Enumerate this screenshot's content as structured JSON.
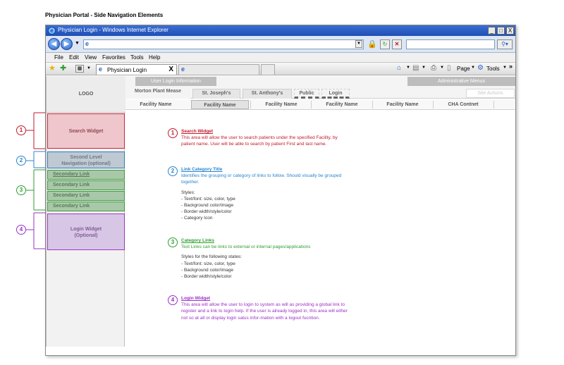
{
  "heading": "Physician Portal - Side Navigation Elements",
  "browser": {
    "title": "Physician Login - Windows Internet Explorer",
    "window_buttons": [
      "_",
      "□",
      "X"
    ],
    "menu": [
      "File",
      "Edit",
      "View",
      "Favorites",
      "Tools",
      "Help"
    ],
    "active_tab": "Physician Login",
    "tab_close": "X",
    "commands": [
      "Page",
      "Tools"
    ],
    "chevron": "»"
  },
  "portal": {
    "logo": "LOGO",
    "user_login_info": "User Login Information",
    "admin_menus": "Administrative Menus",
    "tabs": [
      "Morton Plant Mease",
      "St. Joseph's",
      "St. Anthony's",
      "Public",
      "Login"
    ],
    "site_actions": "Site Actions",
    "facilities": [
      "Facility Name",
      "Facility Name",
      "Facility Name",
      "Facility Name",
      "Facility Name",
      "CHA Contnet"
    ],
    "search_widget": "Search Widget",
    "second_level_nav": [
      "Second Level",
      "Navigation (optional)"
    ],
    "secondary_links": [
      "Secondary Link",
      "Secondary Link",
      "Secondary Link",
      "Secondary Link"
    ],
    "login_widget": [
      "Login Widget",
      "(Optional)"
    ]
  },
  "callouts": [
    "1",
    "2",
    "3",
    "4"
  ],
  "colors": {
    "red": "#c21a2b",
    "blue": "#2a84cc",
    "green": "#2f9e2f",
    "purple": "#9b30c8"
  },
  "descriptions": [
    {
      "num": "1",
      "title": "Search Widget",
      "body": "This area will allow the user to search patients under the specified Facility, by patient name. User will be able to search by patient First and last name.",
      "styles": ""
    },
    {
      "num": "2",
      "title": "Link Category Title",
      "body": "Identifies the grouping or category of links to follow. Should visually be grouped together.",
      "styles": "Styles:\n   - Text/font: size, color, type\n   - Background color/image\n   - Border width/style/color\n   - Category Icon"
    },
    {
      "num": "3",
      "title": "Category Links",
      "body": "Text Links can be links to external or internal pages/applications",
      "styles": "Styles for the following states:\n   - Text/font: size, color, type\n   - Background color/image\n   - Border width/style/color"
    },
    {
      "num": "4",
      "title": "Login Widget",
      "body": "This area will allow the user to login to system as will as providing a global link to register and a link to login help. If the user is already logged in, this area will either not so at all or display login satus infor-mation with a logout fucntion.",
      "styles": ""
    }
  ]
}
